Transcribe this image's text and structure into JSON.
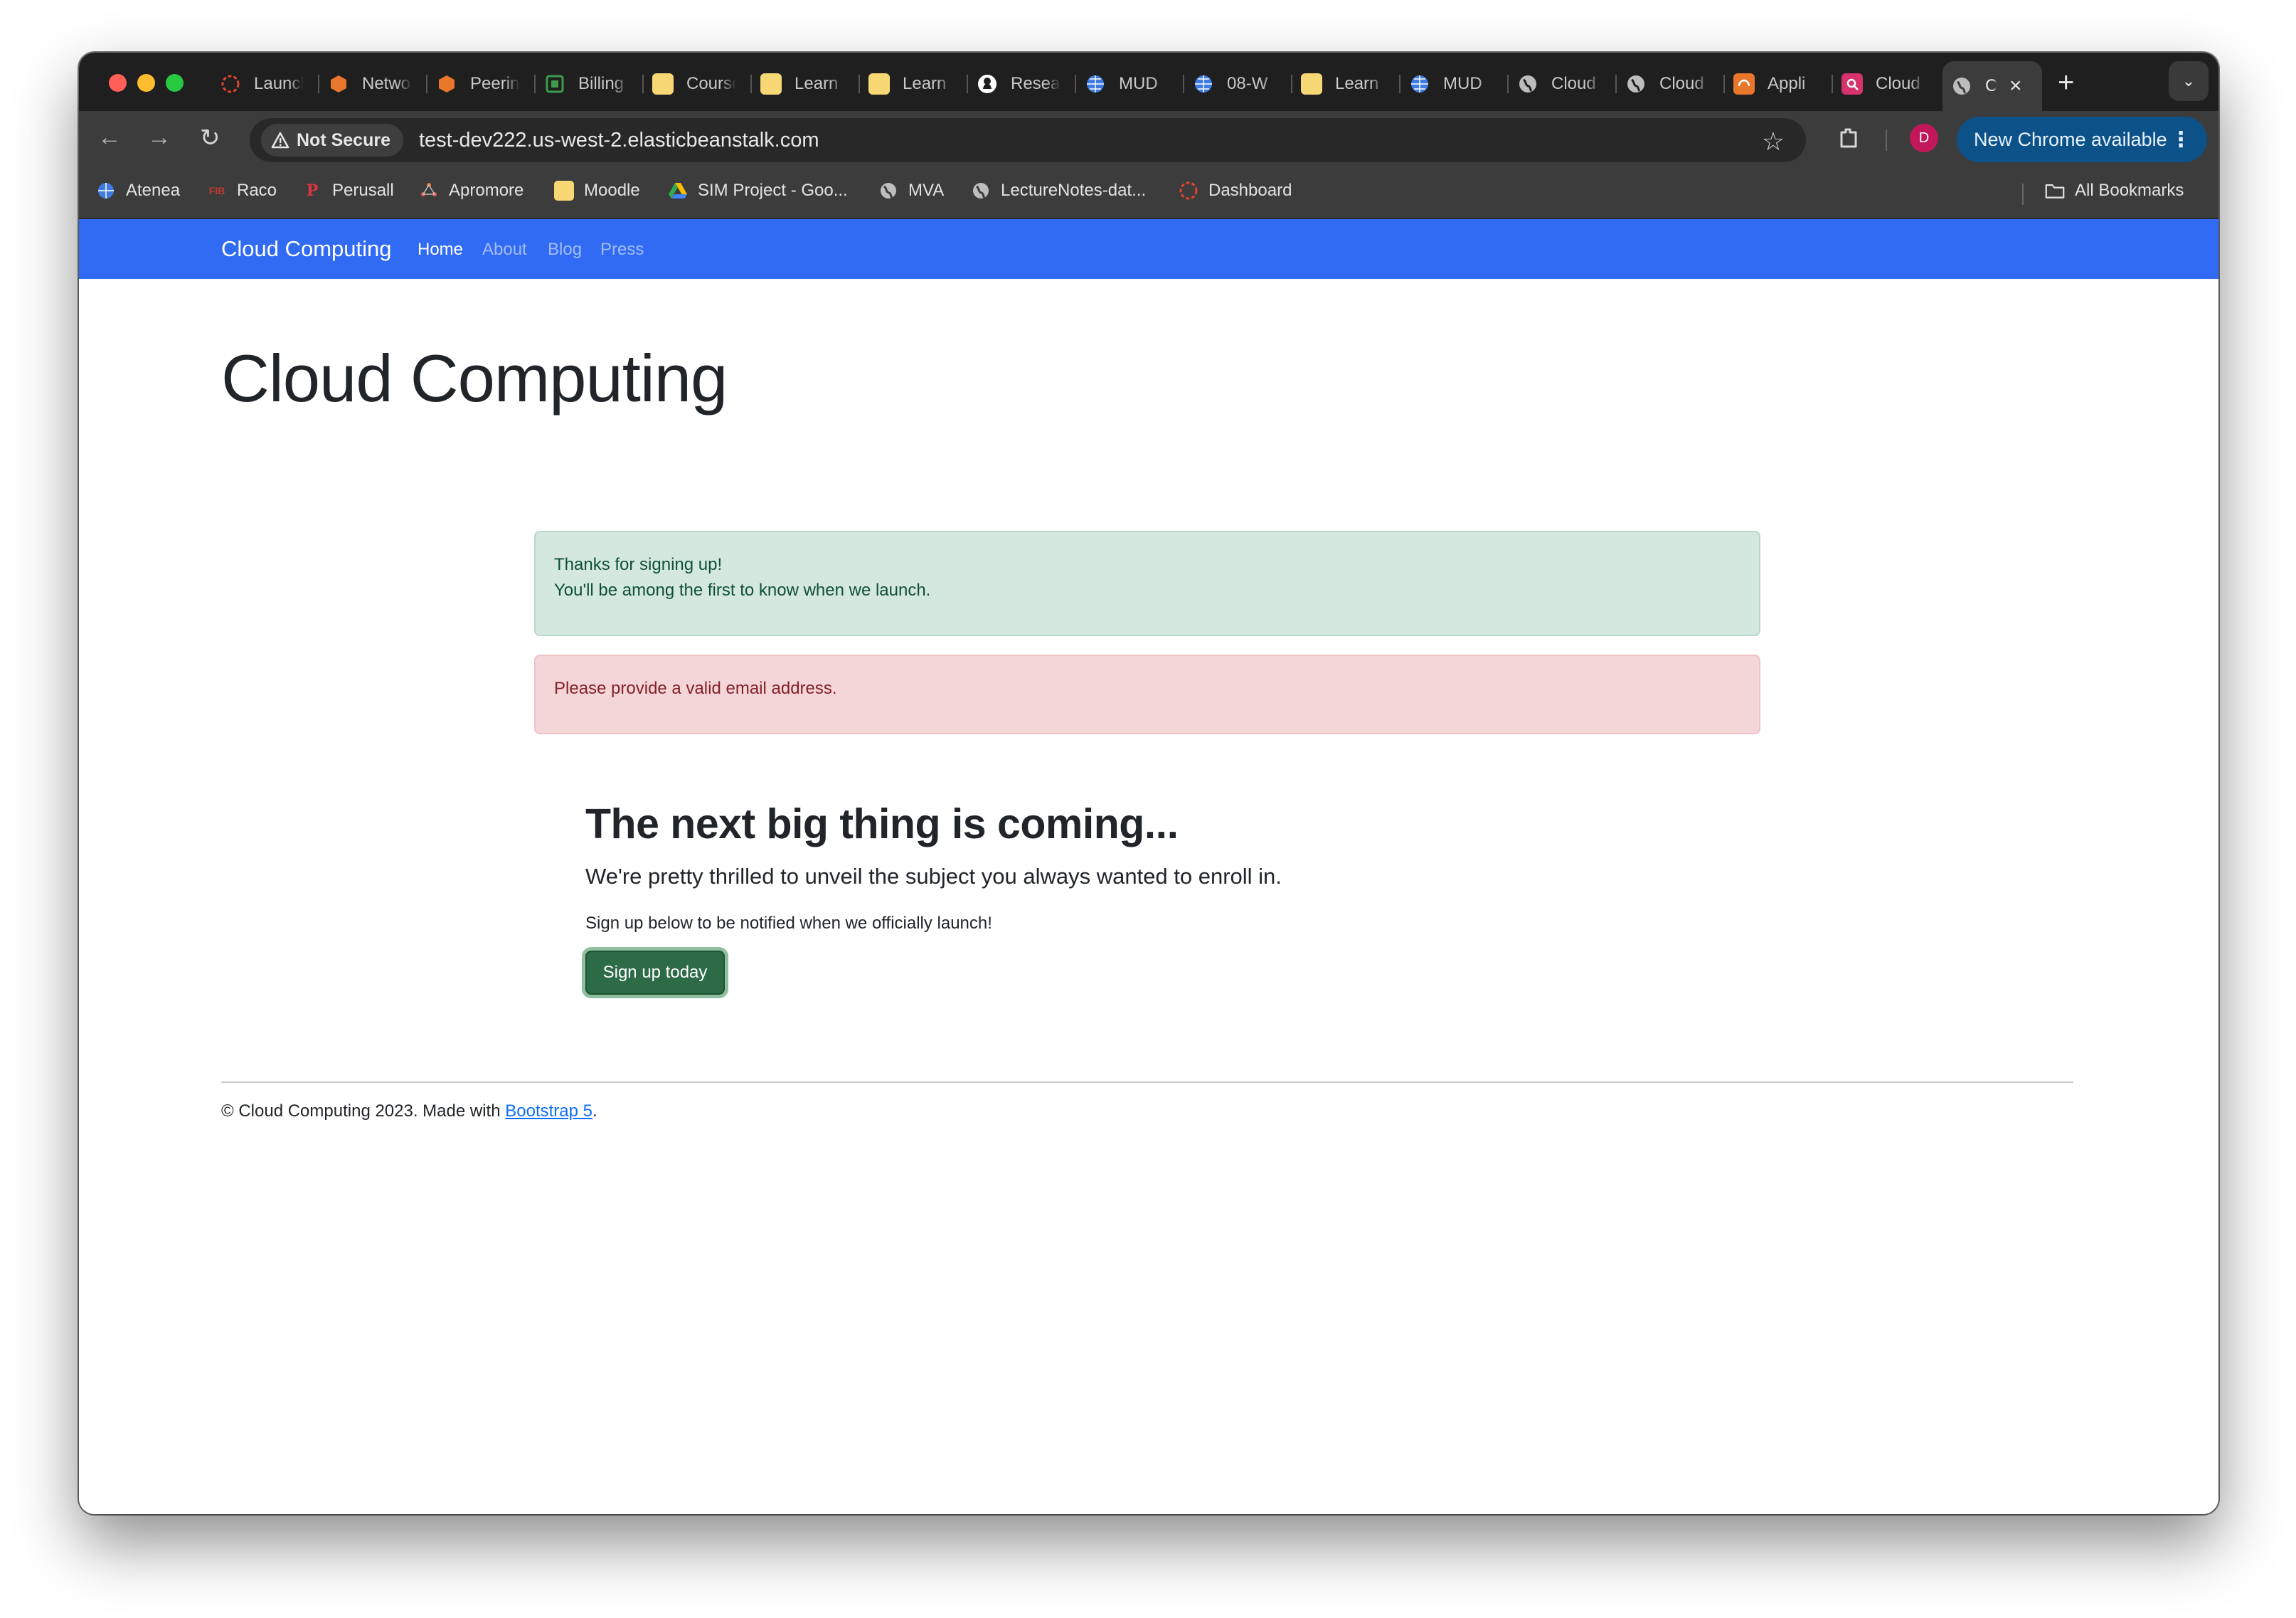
{
  "browser": {
    "tabs": [
      {
        "label": "Launch",
        "icon": "launch-icon",
        "color": "#e0442f"
      },
      {
        "label": "Network",
        "icon": "aws-box-icon",
        "color": "#e8762b"
      },
      {
        "label": "Peering",
        "icon": "aws-box-icon",
        "color": "#e8762b"
      },
      {
        "label": "Billing",
        "icon": "billing-icon",
        "color": "#3d9b4a"
      },
      {
        "label": "Course",
        "icon": "note-icon",
        "color": "#f8d775"
      },
      {
        "label": "Learn",
        "icon": "note-icon",
        "color": "#f8d775"
      },
      {
        "label": "Learn",
        "icon": "note-icon",
        "color": "#f8d775"
      },
      {
        "label": "Research",
        "icon": "github-icon",
        "color": "#ffffff"
      },
      {
        "label": "MUD",
        "icon": "globe-grid-icon",
        "color": "#3f7be0"
      },
      {
        "label": "08-W",
        "icon": "globe-grid-icon",
        "color": "#3f7be0"
      },
      {
        "label": "Learn",
        "icon": "note-icon",
        "color": "#f8d775"
      },
      {
        "label": "MUD",
        "icon": "globe-grid-icon",
        "color": "#3f7be0"
      },
      {
        "label": "Cloud",
        "icon": "globe-icon",
        "color": "#bdbdbd"
      },
      {
        "label": "Cloud",
        "icon": "globe-icon",
        "color": "#bdbdbd"
      },
      {
        "label": "Appli",
        "icon": "aws-app-icon",
        "color": "#e8762b"
      },
      {
        "label": "Cloud",
        "icon": "aws-cloud-icon",
        "color": "#d6336c"
      }
    ],
    "active_tab": {
      "label": "C",
      "icon": "globe-icon"
    },
    "not_secure_label": "Not Secure",
    "url": "test-dev222.us-west-2.elasticbeanstalk.com",
    "profile_initial": "D",
    "update_button": "New Chrome available",
    "bookmarks": [
      {
        "label": "Atenea",
        "icon": "grid-globe-icon"
      },
      {
        "label": "Raco",
        "icon": "fib-icon"
      },
      {
        "label": "Perusall",
        "icon": "perusall-icon"
      },
      {
        "label": "Apromore",
        "icon": "apromore-icon"
      },
      {
        "label": "Moodle",
        "icon": "note-icon"
      },
      {
        "label": "SIM Project - Goo...",
        "icon": "drive-icon"
      },
      {
        "label": "MVA",
        "icon": "globe-icon"
      },
      {
        "label": "LectureNotes-dat...",
        "icon": "globe-icon"
      },
      {
        "label": "Dashboard",
        "icon": "dashboard-icon"
      }
    ],
    "all_bookmarks_label": "All Bookmarks"
  },
  "site": {
    "brand": "Cloud Computing",
    "nav": [
      {
        "label": "Home",
        "active": true
      },
      {
        "label": "About",
        "active": false
      },
      {
        "label": "Blog",
        "active": false
      },
      {
        "label": "Press",
        "active": false
      }
    ],
    "heading": "Cloud Computing",
    "alert_success": {
      "line1": "Thanks for signing up!",
      "line2": "You'll be among the first to know when we launch."
    },
    "alert_danger": "Please provide a valid email address.",
    "hero": {
      "title": "The next big thing is coming...",
      "lead": "We're pretty thrilled to unveil the subject you always wanted to enroll in.",
      "text": "Sign up below to be notified when we officially launch!",
      "button": "Sign up today"
    },
    "footer": {
      "prefix": "© Cloud Computing 2023. Made with ",
      "link": "Bootstrap 5",
      "suffix": "."
    },
    "colors": {
      "navbar": "#316bf4",
      "success_bg": "#d4e8e0",
      "danger_bg": "#f4d6d9",
      "button": "#2d6b47"
    }
  }
}
